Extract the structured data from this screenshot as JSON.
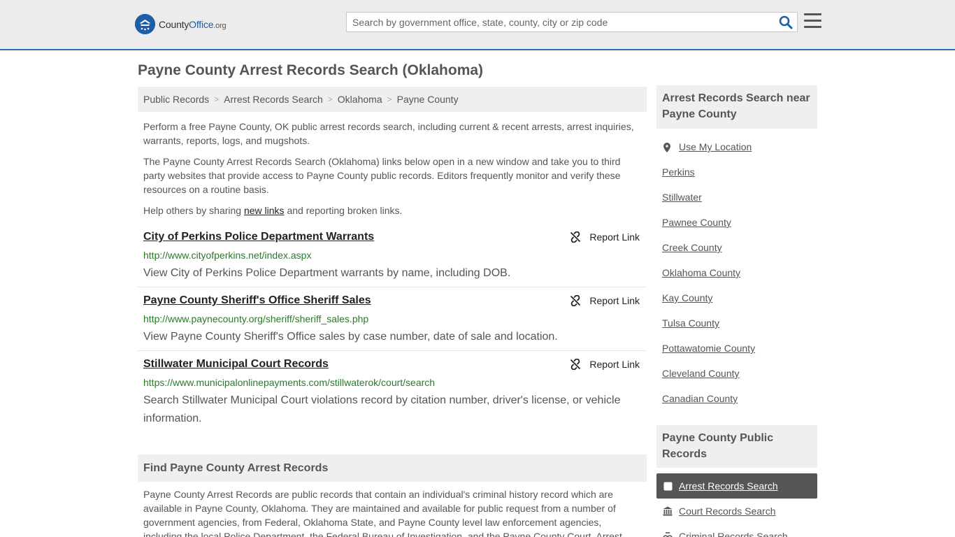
{
  "header": {
    "logo_text_main": "County",
    "logo_text_accent": "Office",
    "logo_text_org": ".org",
    "search_placeholder": "Search by government office, state, county, city or zip code"
  },
  "page_title": "Payne County Arrest Records Search (Oklahoma)",
  "breadcrumb": [
    "Public Records",
    "Arrest Records Search",
    "Oklahoma",
    "Payne County"
  ],
  "intro": {
    "p1": "Perform a free Payne County, OK public arrest records search, including current & recent arrests, arrest inquiries, warrants, reports, logs, and mugshots.",
    "p2": "The Payne County Arrest Records Search (Oklahoma) links below open in a new window and take you to third party websites that provide access to Payne County public records. Editors frequently monitor and verify these resources on a routine basis.",
    "p3_before": "Help others by sharing ",
    "p3_link": "new links",
    "p3_after": " and reporting broken links."
  },
  "results": [
    {
      "title": "City of Perkins Police Department Warrants",
      "url": "http://www.cityofperkins.net/index.aspx",
      "desc": "View City of Perkins Police Department warrants by name, including DOB.",
      "report": "Report Link"
    },
    {
      "title": "Payne County Sheriff's Office Sheriff Sales",
      "url": "http://www.paynecounty.org/sheriff/sheriff_sales.php",
      "desc": "View Payne County Sheriff's Office sales by case number, date of sale and location.",
      "report": "Report Link"
    },
    {
      "title": "Stillwater Municipal Court Records",
      "url": "https://www.municipalonlinepayments.com/stillwaterok/court/search",
      "desc": "Search Stillwater Municipal Court violations record by citation number, driver's license, or vehicle information.",
      "report": "Report Link"
    }
  ],
  "find": {
    "title": "Find Payne County Arrest Records",
    "body": "Payne County Arrest Records are public records that contain an individual's criminal history record which are available in Payne County, Oklahoma. They are maintained and available for public request from a number of government agencies, from Federal, Oklahoma State, and Payne County level law enforcement agencies, including the local Police Department, the Federal Bureau of Investigation, and the Payne County Court. Arrest"
  },
  "sidebar": {
    "near_title": "Arrest Records Search near Payne County",
    "use_location": "Use My Location",
    "near_links": [
      "Perkins",
      "Stillwater",
      "Pawnee County",
      "Creek County",
      "Oklahoma County",
      "Kay County",
      "Tulsa County",
      "Pottawatomie County",
      "Cleveland County",
      "Canadian County"
    ],
    "public_title": "Payne County Public Records",
    "public_links": [
      "Arrest Records Search",
      "Court Records Search",
      "Criminal Records Search"
    ]
  }
}
